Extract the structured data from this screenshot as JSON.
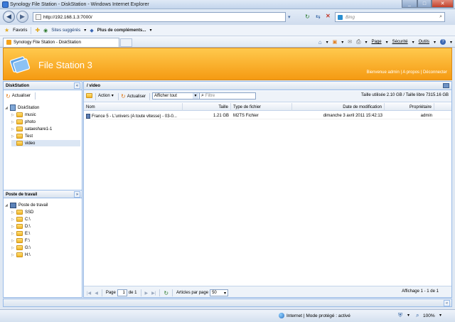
{
  "window": {
    "title": "Synology File Station - DiskStation - Windows Internet Explorer"
  },
  "address_bar": {
    "url": "http://192.168.1.3:7000/",
    "search_placeholder": "Bing"
  },
  "favorites_bar": {
    "favorites_label": "Favoris",
    "suggested_label": "Sites suggérés",
    "more_addons_label": "Plus de compléments..."
  },
  "tab": {
    "title": "Synology File Station - DiskStation"
  },
  "command_bar": {
    "page_label": "Page",
    "security_label": "Sécurité",
    "tools_label": "Outils"
  },
  "app": {
    "title": "File Station 3",
    "welcome_text": "Bienvenue admin",
    "about_label": "A propos",
    "logout_label": "Déconnecter",
    "separator": " | "
  },
  "left_panel": {
    "header": "DiskStation",
    "refresh_label": "Actualiser",
    "root": "DiskStation",
    "folders": [
      "music",
      "photo",
      "sataeshare1-1",
      "Test",
      "video"
    ],
    "selected_folder": "video"
  },
  "workstation_panel": {
    "header": "Poste de travail",
    "root": "Poste de travail",
    "drives": [
      "SSD",
      "C:\\",
      "D:\\",
      "E:\\",
      "F:\\",
      "G:\\",
      "H:\\"
    ]
  },
  "main_panel": {
    "path": "/ video",
    "action_label": "Action",
    "refresh_label": "Actualiser",
    "filter_select": "Afficher tout",
    "filter_placeholder": "Filtre",
    "space_info": "Taille utilisée 2.10 GB / Taille libre 7315.16 GB",
    "columns": [
      "Nom",
      "Taille",
      "Type de fichier",
      "Date de modification",
      "Propriétaire"
    ],
    "rows": [
      {
        "name": "France 5 - L'univers (A toute vitesse) - 03-0...",
        "size": "1.21 GB",
        "type": "M2TS Fichier",
        "modified": "dimanche 3 avril 2011 15:42:13",
        "owner": "admin"
      }
    ]
  },
  "pager": {
    "page_label": "Page",
    "page_value": "1",
    "of_label": "de 1",
    "per_page_label": "Articles par page",
    "per_page_value": "50",
    "display_info": "Affichage 1 - 1 de 1"
  },
  "ie_status": {
    "zone_text": "Internet | Mode protégé : activé",
    "zoom": "100%"
  }
}
